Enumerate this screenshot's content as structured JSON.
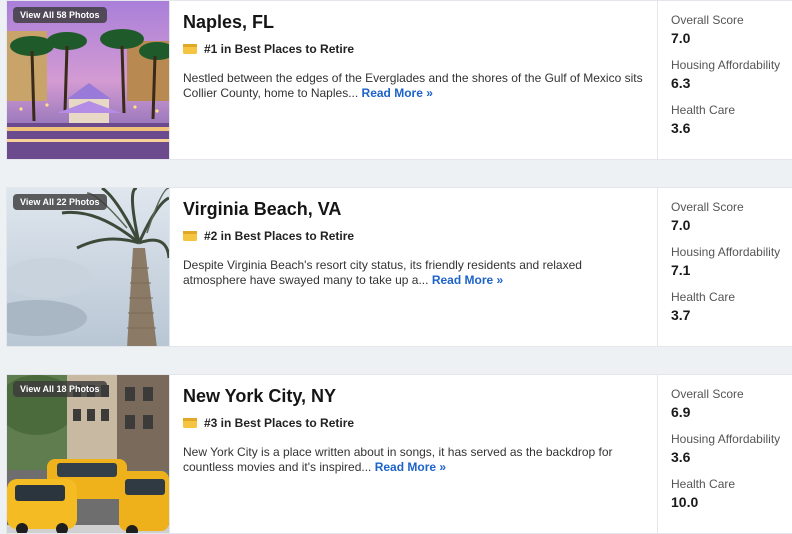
{
  "cards": [
    {
      "photos_label": "View All 58 Photos",
      "title": "Naples, FL",
      "rank": "#1 in Best Places to Retire",
      "description": "Nestled between the edges of the Everglades and the shores of the Gulf of Mexico sits Collier County, home to Naples... ",
      "read_more": "Read More »",
      "scores": [
        {
          "label": "Overall Score",
          "value": "7.0"
        },
        {
          "label": "Housing Affordability",
          "value": "6.3"
        },
        {
          "label": "Health Care",
          "value": "3.6"
        }
      ]
    },
    {
      "photos_label": "View All 22 Photos",
      "title": "Virginia Beach, VA",
      "rank": "#2 in Best Places to Retire",
      "description": "Despite Virginia Beach's resort city status, its friendly residents and relaxed atmosphere have swayed many to take up a... ",
      "read_more": "Read More »",
      "scores": [
        {
          "label": "Overall Score",
          "value": "7.0"
        },
        {
          "label": "Housing Affordability",
          "value": "7.1"
        },
        {
          "label": "Health Care",
          "value": "3.7"
        }
      ]
    },
    {
      "photos_label": "View All 18 Photos",
      "title": "New York City, NY",
      "rank": "#3 in Best Places to Retire",
      "description": "New York City is a place written about in songs, it has served as the backdrop for countless movies and it's inspired... ",
      "read_more": "Read More »",
      "scores": [
        {
          "label": "Overall Score",
          "value": "6.9"
        },
        {
          "label": "Housing Affordability",
          "value": "3.6"
        },
        {
          "label": "Health Care",
          "value": "10.0"
        }
      ]
    }
  ],
  "colors": {
    "link": "#1d63c9",
    "rank_icon": "#f5c542"
  },
  "icons": {
    "rank": "ticket-icon"
  }
}
